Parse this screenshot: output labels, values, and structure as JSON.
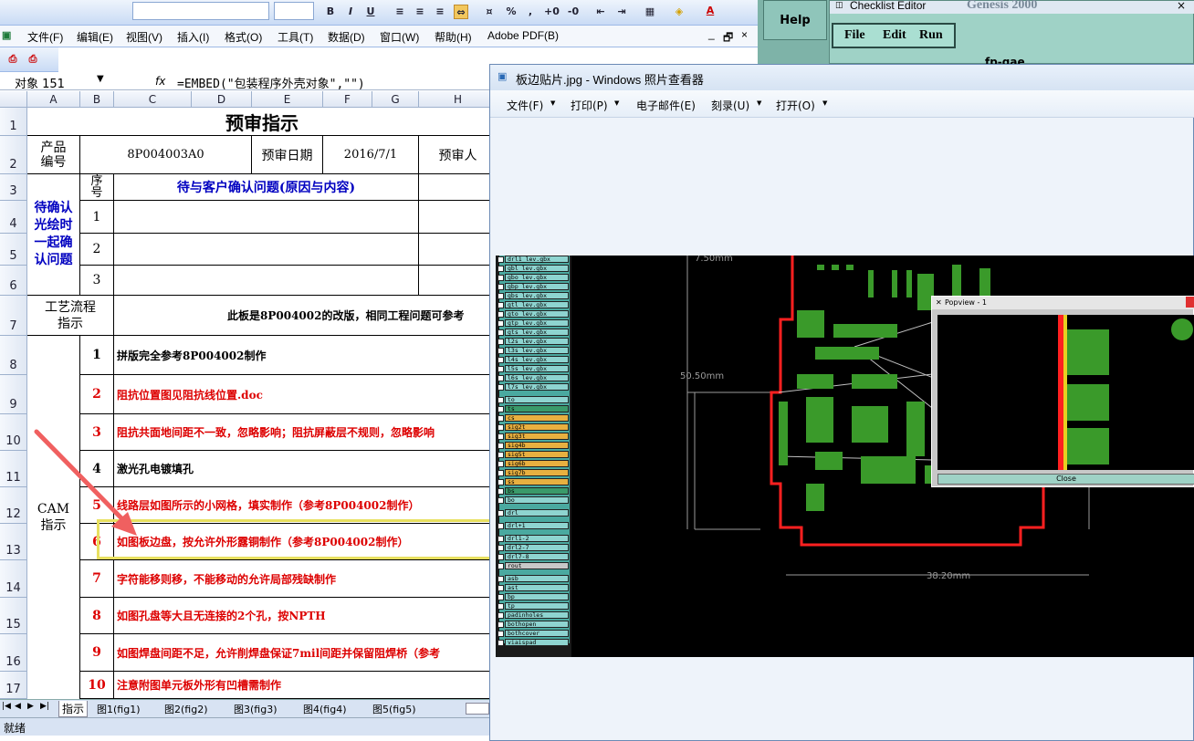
{
  "excel": {
    "font_box": "",
    "size_box": "",
    "menu": [
      "文件(F)",
      "编辑(E)",
      "视图(V)",
      "插入(I)",
      "格式(O)",
      "工具(T)",
      "数据(D)",
      "窗口(W)",
      "帮助(H)",
      "Adobe PDF(B)"
    ],
    "window_controls": [
      "_",
      "🗗",
      "×"
    ],
    "name_box": "对象 151",
    "fx": "fx",
    "formula": "=EMBED(\"包装程序外壳对象\",\"\")",
    "columns": [
      "A",
      "B",
      "C",
      "D",
      "E",
      "F",
      "G",
      "H"
    ],
    "rows": [
      "1",
      "2",
      "3",
      "4",
      "5",
      "6",
      "7",
      "8",
      "9",
      "10",
      "11",
      "12",
      "13",
      "14",
      "15",
      "16",
      "17"
    ],
    "title": "预审指示",
    "product_no_label": "产品\n编号",
    "product_no": "8P004003A0",
    "review_date_label": "预审日期",
    "review_date": "2016/7/1",
    "reviewer_label": "预审人",
    "confirm_label": "待确认\n光绘时\n一起确\n认问题",
    "seq_label": "序\n号",
    "confirm_header": "待与客户确认问题(原因与内容)",
    "confirm_nums": [
      "1",
      "2",
      "3"
    ],
    "process_label": "工艺流程\n指示",
    "process_text": "此板是8P004002的改版，相同工程问题可参考",
    "cam_label": "CAM\n指示",
    "instructions": [
      {
        "num": "1",
        "text": "拼版完全参考8P004002制作",
        "red": false
      },
      {
        "num": "2",
        "text": "阻抗位置图见阻抗线位置.doc",
        "red": true
      },
      {
        "num": "3",
        "text": "阻抗共面地间距不一致，忽略影响；阻抗屏蔽层不规则，忽略影响",
        "red": true
      },
      {
        "num": "4",
        "text": "激光孔电镀填孔",
        "red": false
      },
      {
        "num": "5",
        "text": "线路层如图所示的小网格，填实制作（参考8P004002制作）",
        "red": true
      },
      {
        "num": "6",
        "text": "如图板边盘，按允许外形露铜制作（参考8P004002制作）",
        "red": true
      },
      {
        "num": "7",
        "text": "字符能移则移，不能移动的允许局部残缺制作",
        "red": true
      },
      {
        "num": "8",
        "text": "如图孔盘等大且无连接的2个孔，按NPTH",
        "red": true
      },
      {
        "num": "9",
        "text": "如图焊盘间距不足，允许削焊盘保证7mil间距并保留阻焊桥（参考",
        "red": true
      },
      {
        "num": "10",
        "text": "注意附图单元板外形有凹槽需制作",
        "red": true
      }
    ],
    "sheet_tabs": [
      "指示",
      "图1(fig1)",
      "图2(fig2)",
      "图3(fig3)",
      "图4(fig4)",
      "图5(fig5)"
    ],
    "status": "就绪"
  },
  "genesis": {
    "help": "Help",
    "checklist_title": "Checklist Editor",
    "menu": [
      "File",
      "Edit",
      "Run"
    ],
    "job": "fp-gae",
    "genesis_logo": "Genesis 2000"
  },
  "viewer": {
    "title": "板边贴片.jpg - Windows 照片查看器",
    "menu": [
      "文件(F)",
      "打印(P)",
      "电子邮件(E)",
      "刻录(U)",
      "打开(O)"
    ],
    "layers": [
      "drl1_lev.gbx",
      "gbl_lev.gbx",
      "gbo_lev.gbx",
      "gbp_lev.gbx",
      "gbs_lev.gbx",
      "gtl_lev.gbx",
      "gto_lev.gbx",
      "gtp_lev.gbx",
      "gts_lev.gbx",
      "l2s_lev.gbx",
      "l3s_lev.gbx",
      "l4s_lev.gbx",
      "l5s_lev.gbx",
      "l6s_lev.gbx",
      "l7s_lev.gbx",
      "to",
      "ts",
      "cs",
      "sig2t",
      "sig3t",
      "sig4b",
      "sig5t",
      "sig6b",
      "sig7b",
      "ss",
      "bs",
      "bo",
      "drl",
      "drl+1",
      "drl1-2",
      "drl2-7",
      "drl7-8",
      "rout",
      "asb",
      "ast",
      "bp",
      "tp",
      "padinholes",
      "bothopen",
      "bothcover",
      "viaispad"
    ],
    "dim_vertical": "50.50mm",
    "dim_horizontal": "38.20mm",
    "dim_top": "7.50mm",
    "popview_title": "Popview - 1",
    "popview_close": "Close"
  },
  "colors": {
    "accent_red": "#d00000",
    "excel_blue": "#0000c0",
    "highlight_yellow": "#e8e060",
    "pcb_green": "#3a9a2a",
    "pcb_outline": "#ff2020"
  }
}
